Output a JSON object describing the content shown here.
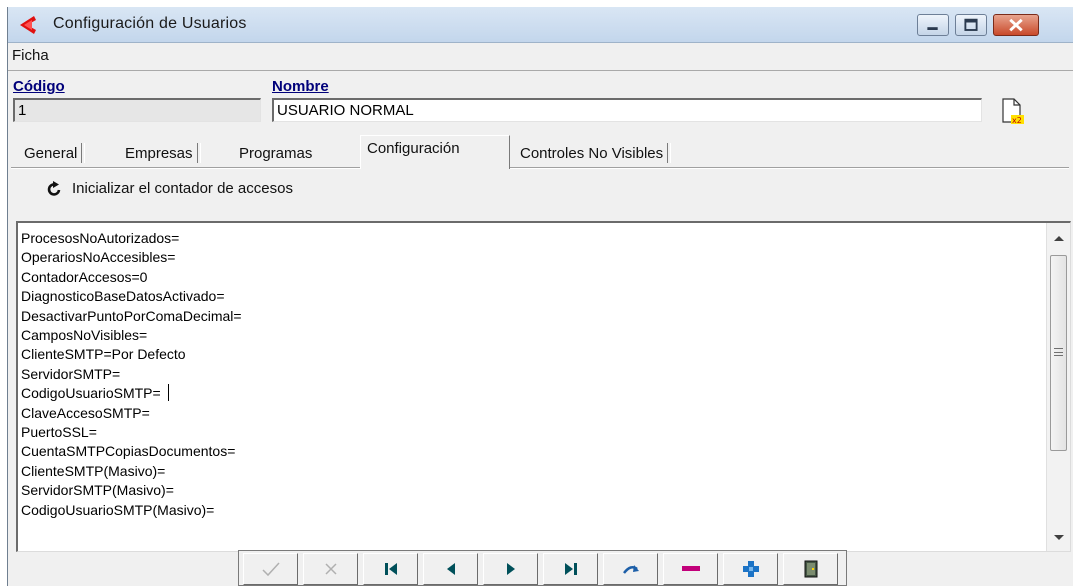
{
  "window": {
    "title": "Configuración de Usuarios"
  },
  "menu": {
    "items": [
      "Ficha"
    ]
  },
  "form": {
    "codigo_label": "Código",
    "codigo_value": "1",
    "nombre_label": "Nombre",
    "nombre_value": "USUARIO NORMAL"
  },
  "tabs": [
    {
      "label": "General",
      "active": false
    },
    {
      "label": "Empresas",
      "active": false
    },
    {
      "label": "Programas",
      "active": false
    },
    {
      "label": "Configuración",
      "active": true
    },
    {
      "label": "Controles No Visibles",
      "active": false
    }
  ],
  "reset_button": {
    "label": "Inicializar el contador de accesos",
    "icon": "refresh-icon"
  },
  "config_lines": [
    "ProcesosNoAutorizados=",
    "OperariosNoAccesibles=",
    "ContadorAccesos=0",
    "DiagnosticoBaseDatosActivado=",
    "DesactivarPuntoPorComaDecimal=",
    "CamposNoVisibles=",
    "ClienteSMTP=Por Defecto",
    "ServidorSMTP=",
    "CodigoUsuarioSMTP=",
    "ClaveAccesoSMTP=",
    "PuertoSSL=",
    "CuentaSMTPCopiasDocumentos=",
    "ClienteSMTP(Masivo)=",
    "ServidorSMTP(Masivo)=",
    "CodigoUsuarioSMTP(Masivo)="
  ],
  "nav_buttons": [
    {
      "icon": "check-icon",
      "enabled": false
    },
    {
      "icon": "cancel-icon",
      "enabled": false
    },
    {
      "icon": "first-record-icon",
      "enabled": true
    },
    {
      "icon": "prev-record-icon",
      "enabled": true
    },
    {
      "icon": "next-record-icon",
      "enabled": true
    },
    {
      "icon": "last-record-icon",
      "enabled": true
    },
    {
      "icon": "refresh-icon",
      "enabled": true
    },
    {
      "icon": "delete-icon",
      "enabled": true
    },
    {
      "icon": "add-icon",
      "enabled": true
    },
    {
      "icon": "exit-icon",
      "enabled": true
    }
  ],
  "colors": {
    "label_blue": "#00007a",
    "delete_magenta": "#c2007a",
    "add_blue": "#1d74c6",
    "nav_teal": "#00505a"
  }
}
